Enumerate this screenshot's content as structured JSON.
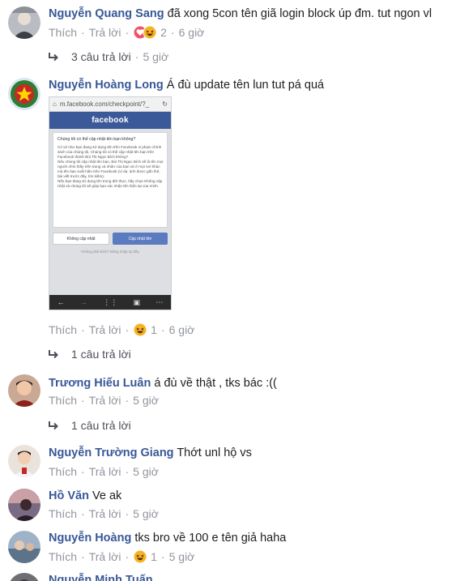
{
  "ui": {
    "like": "Thích",
    "reply": "Trả lời",
    "sep": "·"
  },
  "comments": [
    {
      "author": "Nguyễn Quang Sang",
      "text": "đã xong 5con tên giã login block úp đm. tut ngon vl",
      "reactions": [
        "love-icon",
        "haha-icon"
      ],
      "reaction_count": "2",
      "time": "6 giờ",
      "replies": {
        "label": "3 câu trả lời",
        "time": "5 giờ"
      }
    },
    {
      "author": "Nguyễn Hoàng Long",
      "text": "Á đù update tên lun tut pá quá",
      "reactions": [
        "haha-icon"
      ],
      "reaction_count": "1",
      "time": "6 giờ",
      "replies": {
        "label": "1 câu trả lời",
        "time": ""
      },
      "attachment": {
        "url": "m.facebook.com/checkpoint/?_",
        "brand": "facebook",
        "question": "Chúng tôi có thể cập nhật tên bạn không?",
        "body": "Có vẻ như bạn đang sử dụng tên trên Facebook vi phạm chính sách của chúng tôi. Chúng tôi có thể cập nhật tên bạn trên Facebook thành Bùi Thị Ngọc Bích không?\nNếu chúng tôi cập nhật tên bạn, Bùi Thị Ngọc Bích sẽ là tên mọi người nhìn thấy trên trang cá nhân của bạn và ở mọi nơi khác mà tên bạn xuất hiện trên Facebook (ví dụ: ảnh được gắn thẻ, bài viết trước đây, tìm kiếm).\nNếu bạn đang sử dụng tên trong đời thực, hãy chọn Không cập nhật và chúng tôi sẽ giúp bạn xác nhận tên hiện tại của mình.",
        "btn_no": "Không cập nhật",
        "btn_yes": "Cập nhật tên",
        "not_me": "Không phải Bích? Đăng nhập tại đây"
      }
    },
    {
      "author": "Trương Hiếu Luân",
      "text": "á đù về thật , tks bác :((",
      "time": "5 giờ",
      "replies": {
        "label": "1 câu trả lời",
        "time": ""
      }
    },
    {
      "author": "Nguyễn Trường Giang",
      "text": "Thớt unl hộ vs",
      "time": "5 giờ"
    },
    {
      "author": "Hồ Văn",
      "text": "Ve ak",
      "time": "5 giờ"
    },
    {
      "author": "Nguyễn Hoàng",
      "text": "tks bro về 100 e tên giả haha",
      "reactions": [
        "haha-icon"
      ],
      "reaction_count": "1",
      "time": "5 giờ"
    },
    {
      "author": "Nguyễn Minh Tuấn",
      "text": ""
    }
  ],
  "colors": {
    "author": "#385898",
    "meta": "#90949c",
    "link": "#4b4f56",
    "love": "#f25268",
    "haha": "#f7b125"
  }
}
